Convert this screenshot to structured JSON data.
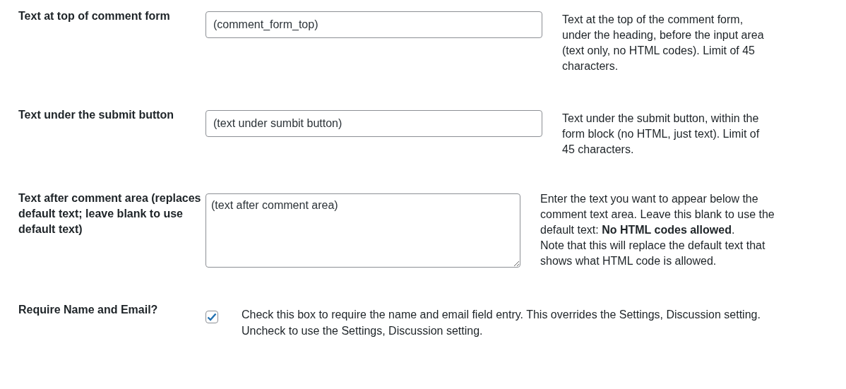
{
  "settings": [
    {
      "kind": "text",
      "label": "Text at top of comment form",
      "value": "(comment_form_top)",
      "description": [
        "Text at the top of the comment form, under the heading, before the input area (text only, no HTML codes). Limit of 45 characters."
      ]
    },
    {
      "kind": "text",
      "label": "Text under the submit button",
      "value": "(text under sumbit button)",
      "description": [
        "Text under the submit button, within the form block (no HTML, just text). Limit of 45 characters."
      ]
    },
    {
      "kind": "textarea",
      "label": "Text after comment area (replaces default text; leave blank to use default text)",
      "value": "(text after comment area)",
      "description": [
        "Enter the text you want to appear below the comment text area. Leave this blank to use the default text: **No HTML codes allowed**.",
        "Note that this will replace the default text that shows what HTML code is allowed."
      ]
    },
    {
      "kind": "checkbox",
      "label": "Require Name and Email?",
      "checked": true,
      "description": [
        "Check this box to require the name and email field entry. This overrides the Settings, Discussion setting. Uncheck to use the Settings, Discussion setting."
      ]
    }
  ]
}
